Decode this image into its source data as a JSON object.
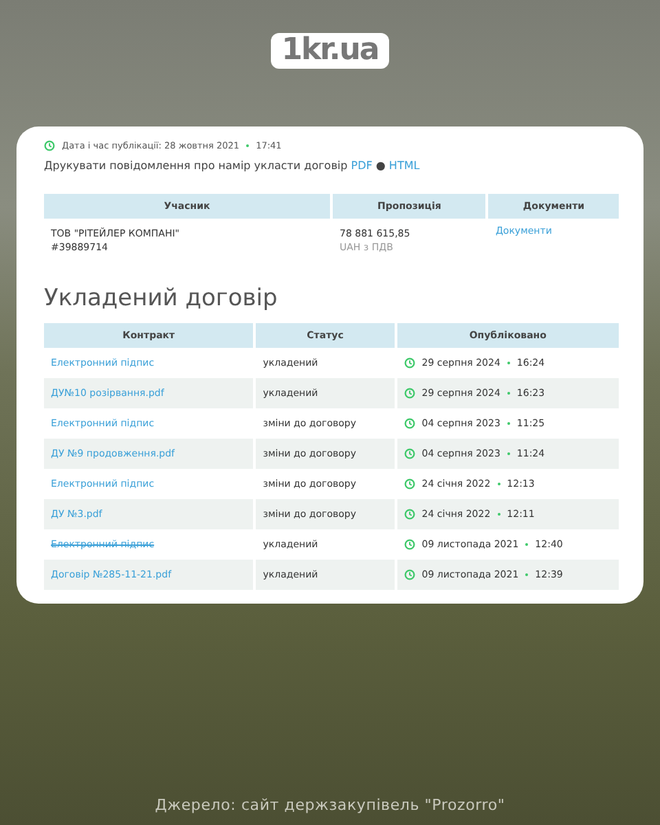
{
  "logo": {
    "text": "1kr.ua"
  },
  "publication": {
    "label": "Дата і час публікації: 28 жовтня 2021",
    "time": "17:41"
  },
  "print_line": {
    "text": "Друкувати повідомлення про намір укласти договір",
    "links": [
      "PDF",
      "HTML"
    ],
    "separator": "●"
  },
  "bids_table": {
    "columns": [
      "Учасник",
      "Пропозиція",
      "Документи"
    ],
    "rows": [
      {
        "participant": "ТОВ \"РІТЕЙЛЕР КОМПАНІ\"",
        "code": "#39889714",
        "amount": "78 881 615,85",
        "currency": "UAH з ПДВ",
        "documents": "Документи"
      }
    ]
  },
  "contract_section": {
    "title": "Укладений договір",
    "columns": [
      "Контракт",
      "Статус",
      "Опубліковано"
    ],
    "rows": [
      {
        "contract": "Електронний підпис",
        "struck": false,
        "status": "укладений",
        "date": "29 серпня 2024",
        "time": "16:24"
      },
      {
        "contract": "ДУ№10 розірвання.pdf",
        "struck": false,
        "status": "укладений",
        "date": "29 серпня 2024",
        "time": "16:23"
      },
      {
        "contract": "Електронний підпис",
        "struck": false,
        "status": "зміни до договору",
        "date": "04 серпня 2023",
        "time": "11:25"
      },
      {
        "contract": "ДУ №9 продовження.pdf",
        "struck": false,
        "status": "зміни до договору",
        "date": "04 серпня 2023",
        "time": "11:24"
      },
      {
        "contract": "Електронний підпис",
        "struck": false,
        "status": "зміни до договору",
        "date": "24 січня 2022",
        "time": "12:13"
      },
      {
        "contract": "ДУ №3.pdf",
        "struck": false,
        "status": "зміни до договору",
        "date": "24 січня 2022",
        "time": "12:11"
      },
      {
        "contract": "Електронний підпис",
        "struck": true,
        "status": "укладений",
        "date": "09 листопада 2021",
        "time": "12:40"
      },
      {
        "contract": "Договір №285-11-21.pdf",
        "struck": false,
        "status": "укладений",
        "date": "09 листопада 2021",
        "time": "12:39"
      }
    ]
  },
  "caption": "Джерело: сайт держзакупівель \"Prozorro\""
}
